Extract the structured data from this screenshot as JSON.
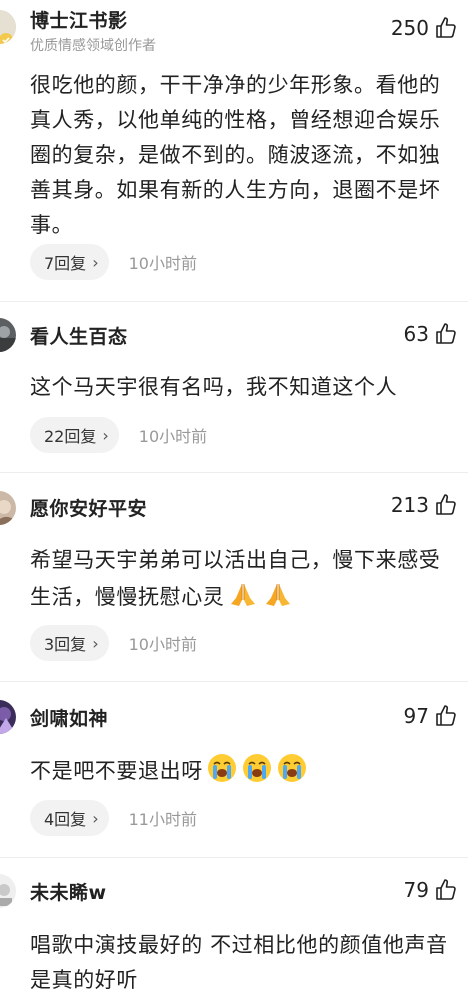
{
  "comments": [
    {
      "username": "博士江书影",
      "badge": "优质情感领域创作者",
      "likes": "250",
      "text": "很吃他的颜，干干净净的少年形象。看他的真人秀，以他单纯的性格，曾经想迎合娱乐圈的复杂，是做不到的。随波逐流，不如独善其身。如果有新的人生方向，退圈不是坏事。",
      "replies": "7回复",
      "time": "10小时前"
    },
    {
      "username": "看人生百态",
      "likes": "63",
      "text": "这个马天宇很有名吗，我不知道这个人",
      "replies": "22回复",
      "time": "10小时前"
    },
    {
      "username": "愿你安好平安",
      "likes": "213",
      "text": "希望马天宇弟弟可以活出自己，慢下来感受生活，慢慢抚慰心灵",
      "replies": "3回复",
      "time": "10小时前"
    },
    {
      "username": "剑啸如神",
      "likes": "97",
      "text": "不是吧不要退出呀",
      "replies": "4回复",
      "time": "11小时前"
    },
    {
      "username": "未未睎w",
      "likes": "79",
      "text": "唱歌中演技最好的 不过相比他的颜值他声音是真的好听"
    }
  ],
  "icons": {
    "like": "thumbs-up-outline-icon",
    "chevron": "chevron-right-icon",
    "pray": "folded-hands-emoji",
    "cry": "loudly-crying-face-emoji"
  },
  "colors": {
    "text": "#222222",
    "secondary": "#999999",
    "pill_bg": "#f2f2f2"
  }
}
